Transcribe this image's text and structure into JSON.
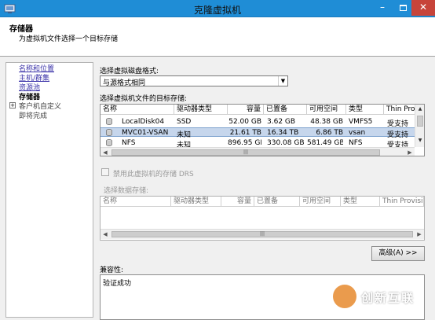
{
  "window": {
    "title": "克隆虚拟机",
    "minimize": "–",
    "close": "✕"
  },
  "header": {
    "title": "存储器",
    "subtitle": "为虚拟机文件选择一个目标存储"
  },
  "nav": {
    "items": [
      {
        "label": "名称和位置",
        "state": "link"
      },
      {
        "label": "主机/群集",
        "state": "link"
      },
      {
        "label": "资源池",
        "state": "link"
      },
      {
        "label": "存储器",
        "state": "current"
      },
      {
        "label": "客户机自定义",
        "state": "pending"
      },
      {
        "label": "即将完成",
        "state": "pending"
      }
    ],
    "expand_glyph": "+"
  },
  "disk_format": {
    "label": "选择虚拟磁盘格式:",
    "value": "与源格式相同"
  },
  "target_storage": {
    "label": "选择虚拟机文件的目标存储:",
    "columns": [
      "名称",
      "驱动器类型",
      "容量",
      "已置备",
      "可用空间",
      "类型",
      "Thin Prov"
    ],
    "rows": [
      {
        "name": "LocalDisk04",
        "drive": "SSD",
        "capacity": "52.00 GB",
        "provisioned": "3.62 GB",
        "free": "48.38 GB",
        "type": "VMFS5",
        "thin": "受支持"
      },
      {
        "name": "MVC01-VSAN",
        "drive": "未知",
        "capacity": "21.61 TB",
        "provisioned": "16.34 TB",
        "free": "6.86 TB",
        "type": "vsan",
        "thin": "受支持"
      },
      {
        "name": "NFS",
        "drive": "未知",
        "capacity": "896.95 GB",
        "provisioned": "330.08 GB",
        "free": "581.49 GB",
        "type": "NFS",
        "thin": "受支持"
      }
    ],
    "selected_index": 1
  },
  "drs": {
    "label": "禁用此虚拟机的存储 DRS",
    "checked": false
  },
  "datastore_select": {
    "label": "选择数据存储:",
    "columns": [
      "名称",
      "驱动器类型",
      "容量",
      "已置备",
      "可用空间",
      "类型",
      "Thin Provisioni"
    ]
  },
  "advanced_button": "高级(A) >>",
  "compatibility": {
    "label": "兼容性:",
    "text": "验证成功"
  },
  "watermark": "创新互联",
  "colors": {
    "titlebar": "#1f8dd6",
    "close": "#c7443a",
    "selection": "#c6d6ec",
    "link": "#3a32a8"
  }
}
